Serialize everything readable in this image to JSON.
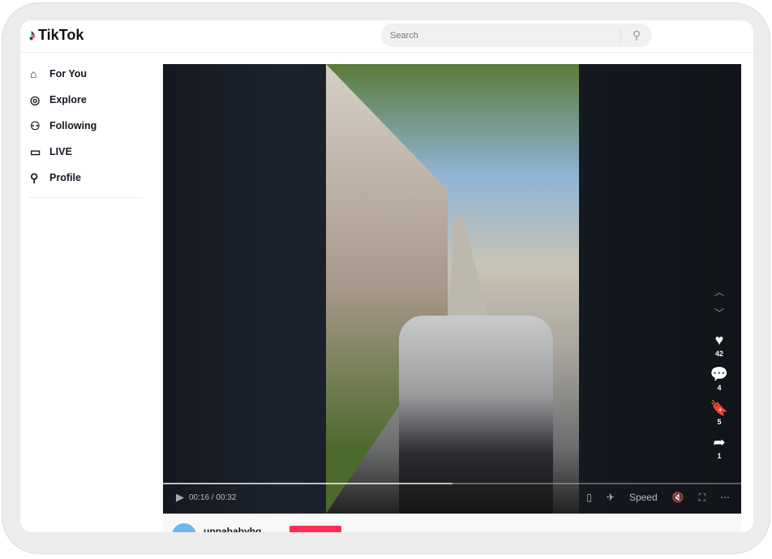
{
  "app": {
    "logo": "TikTok"
  },
  "search": {
    "placeholder": "Search",
    "icon": "search-icon"
  },
  "sidebar": {
    "items": [
      {
        "label": "For You",
        "icon": "home-icon"
      },
      {
        "label": "Explore",
        "icon": "compass-icon"
      },
      {
        "label": "Following",
        "icon": "users-icon"
      },
      {
        "label": "LIVE",
        "icon": "live-icon"
      },
      {
        "label": "Profile",
        "icon": "person-icon"
      }
    ]
  },
  "player": {
    "current_time": "00:16",
    "duration": "00:32",
    "time_display": "00:16 / 00:32",
    "progress_percent": 50,
    "speed_label": "Speed"
  },
  "actions": {
    "likes": "42",
    "comments": "4",
    "saves": "5",
    "shares": "1"
  },
  "author": {
    "username": "uppababyhq"
  },
  "colors": {
    "accent": "#fe2c55"
  }
}
